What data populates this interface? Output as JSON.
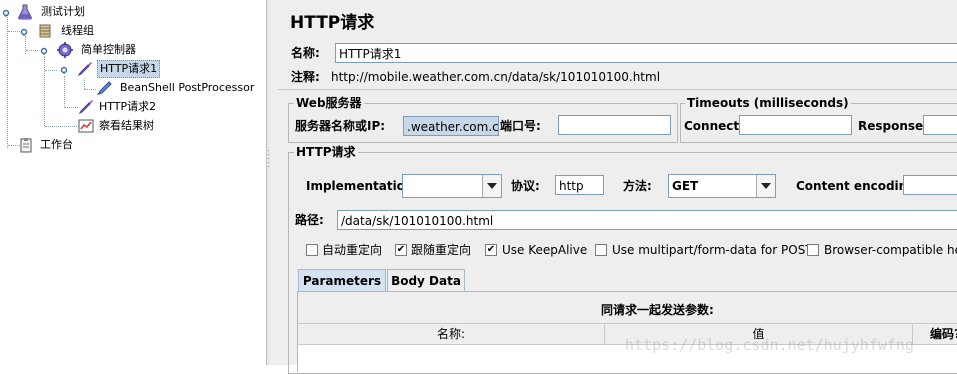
{
  "tree": {
    "items": [
      {
        "label": "测试计划"
      },
      {
        "label": "线程组"
      },
      {
        "label": "简单控制器"
      },
      {
        "label": "HTTP请求1"
      },
      {
        "label": "BeanShell PostProcessor"
      },
      {
        "label": "HTTP请求2"
      },
      {
        "label": "察看结果树"
      },
      {
        "label": "工作台"
      }
    ]
  },
  "panel": {
    "title": "HTTP请求",
    "name_label": "名称:",
    "name_value": "HTTP请求1",
    "comment_label": "注释:",
    "comment_value": "http://mobile.weather.com.cn/data/sk/101010100.html"
  },
  "web_server": {
    "group_title": "Web服务器",
    "server_label": "服务器名称或IP:",
    "server_value": ".weather.com.cn",
    "port_label": "端口号:",
    "port_value": ""
  },
  "timeouts": {
    "group_title": "Timeouts (milliseconds)",
    "connect_label": "Connect:",
    "connect_value": "",
    "response_label": "Response:",
    "response_value": ""
  },
  "http_request": {
    "group_title": "HTTP请求",
    "implementation_label": "Implementation:",
    "implementation_value": "",
    "protocol_label": "协议:",
    "protocol_value": "http",
    "method_label": "方法:",
    "method_value": "GET",
    "encoding_label": "Content encoding:",
    "encoding_value": "",
    "path_label": "路径:",
    "path_value": "/data/sk/101010100.html"
  },
  "options": [
    {
      "label": "自动重定向",
      "checked": false
    },
    {
      "label": "跟随重定向",
      "checked": true
    },
    {
      "label": "Use KeepAlive",
      "checked": true
    },
    {
      "label": "Use multipart/form-data for POST",
      "checked": false
    },
    {
      "label": "Browser-compatible hea",
      "checked": false
    }
  ],
  "tabs": [
    {
      "label": "Parameters",
      "active": true
    },
    {
      "label": "Body Data",
      "active": false
    }
  ],
  "params": {
    "caption": "同请求一起发送参数:",
    "columns": [
      "名称:",
      "值",
      "编码?"
    ]
  },
  "watermark": "https://blog.csdn.net/hujyhfwfng",
  "colors": {
    "selection": "#c8d6ea",
    "field_border": "#7f9db9",
    "panel_bg": "#eeeeee",
    "tab_active": "#d5e2f2"
  }
}
